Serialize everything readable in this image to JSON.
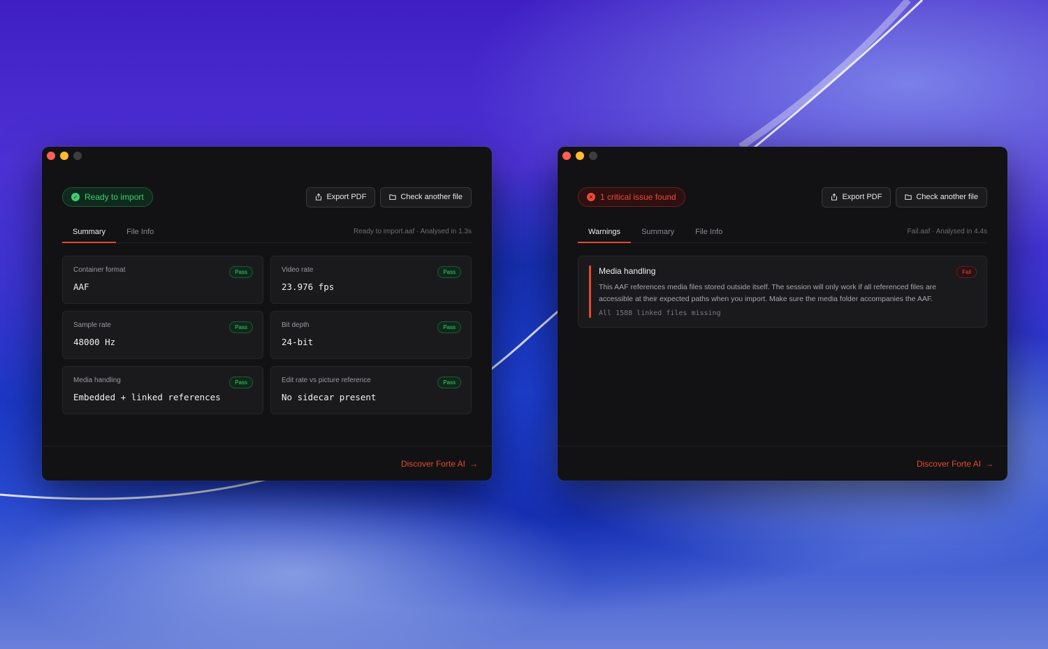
{
  "colors": {
    "accent": "#e34a30",
    "pass": "#3fce72",
    "fail": "#f0483e",
    "window_bg": "#121214"
  },
  "left_window": {
    "status": {
      "label": "Ready to import",
      "icon": "check-circle-icon"
    },
    "actions": {
      "export_label": "Export PDF",
      "check_label": "Check another file"
    },
    "tabs": [
      {
        "label": "Summary",
        "active": true
      },
      {
        "label": "File Info",
        "active": false
      }
    ],
    "meta": {
      "filename": "Ready to import.aaf",
      "separator": "·",
      "analysed": "Analysed in 1.3s"
    },
    "cards": [
      {
        "label": "Container format",
        "value": "AAF",
        "badge": "Pass"
      },
      {
        "label": "Video rate",
        "value": "23.976 fps",
        "badge": "Pass"
      },
      {
        "label": "Sample rate",
        "value": "48000 Hz",
        "badge": "Pass"
      },
      {
        "label": "Bit depth",
        "value": "24-bit",
        "badge": "Pass"
      },
      {
        "label": "Media handling",
        "value": "Embedded + linked references",
        "badge": "Pass"
      },
      {
        "label": "Edit rate vs picture reference",
        "value": "No sidecar present",
        "badge": "Pass"
      }
    ],
    "footer_link": "Discover Forte AI",
    "footer_arrow": "→"
  },
  "right_window": {
    "status": {
      "label": "1 critical issue found",
      "icon": "x-circle-icon"
    },
    "actions": {
      "export_label": "Export PDF",
      "check_label": "Check another file"
    },
    "tabs": [
      {
        "label": "Warnings",
        "active": true
      },
      {
        "label": "Summary",
        "active": false
      },
      {
        "label": "File Info",
        "active": false
      }
    ],
    "meta": {
      "filename": "Fail.aaf",
      "separator": "·",
      "analysed": "Analysed in 4.4s"
    },
    "warning": {
      "title": "Media handling",
      "badge": "Fail",
      "text": "This AAF references media files stored outside itself. The session will only work if all referenced files are accessible at their expected paths when you import. Make sure the media folder accompanies the AAF.",
      "detail": "All 1588 linked files missing"
    },
    "footer_link": "Discover Forte AI",
    "footer_arrow": "→"
  }
}
